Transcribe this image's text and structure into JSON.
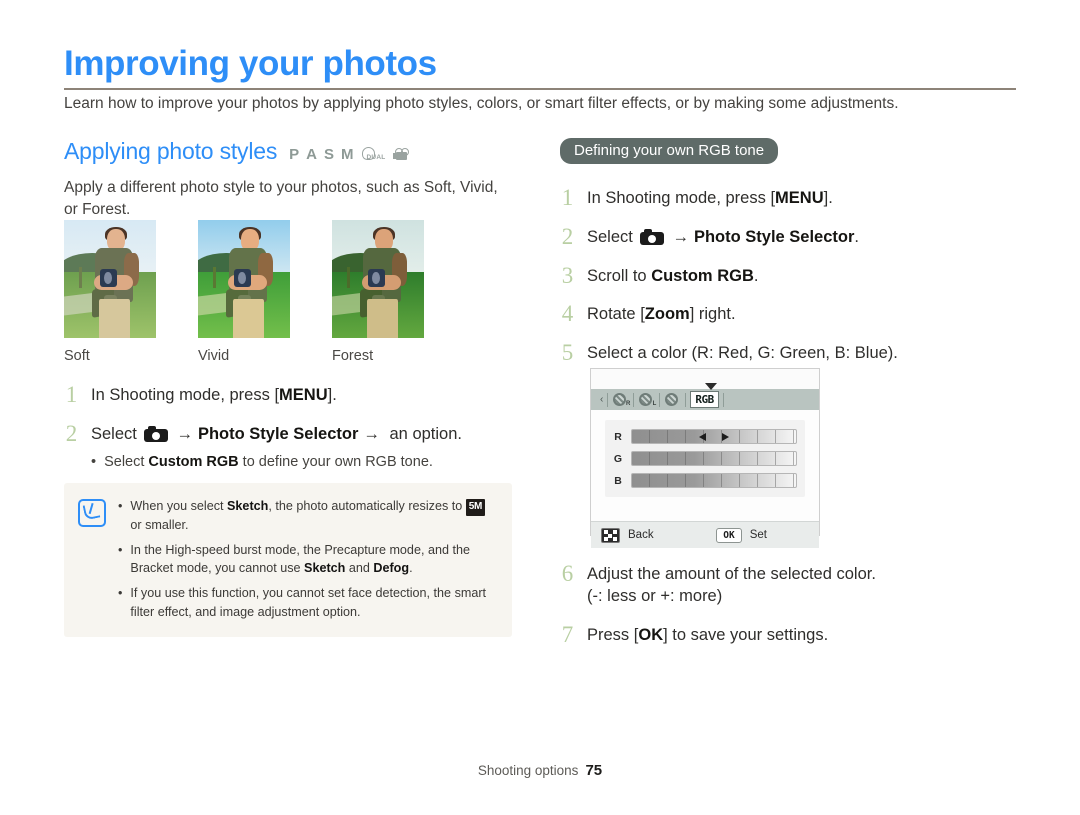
{
  "header": {
    "title": "Improving your photos",
    "intro": "Learn how to improve your photos by applying photo styles, colors, or smart filter effects, or by making some adjustments."
  },
  "left_column": {
    "section_title": "Applying photo styles",
    "modes": [
      "P",
      "A",
      "S",
      "M"
    ],
    "mode_icons": [
      "dual-is-icon",
      "movie-icon"
    ],
    "lead": "Apply a different photo style to your photos, such as Soft, Vivid, or Forest.",
    "samples": [
      {
        "label": "Soft"
      },
      {
        "label": "Vivid"
      },
      {
        "label": "Forest"
      }
    ],
    "steps": [
      {
        "num": "1",
        "pre": "In Shooting mode, press [",
        "key": "MENU",
        "post": "]."
      },
      {
        "num": "2",
        "pre": "Select ",
        "icon": "camera-icon",
        "arrow1": "→",
        "bold1": "Photo Style Selector",
        "arrow2": "→",
        "post": " an option.",
        "sub_bullet": {
          "pre": "Select ",
          "bold": "Custom RGB",
          "post": " to define your own RGB tone."
        }
      }
    ],
    "note": {
      "icon": "note-pen-icon",
      "items": [
        {
          "pre": "When you select ",
          "bold1": "Sketch",
          "mid": ", the photo automatically resizes to ",
          "badge": "5M",
          "post": " or smaller."
        },
        {
          "pre": "In the High-speed burst mode, the Precapture mode, and the Bracket mode, you cannot use ",
          "bold1": "Sketch",
          "mid": " and ",
          "bold2": "Defog",
          "post": "."
        },
        {
          "pre": "If you use this function, you cannot set face detection, the smart filter effect, and image adjustment option.",
          "bold1": "",
          "mid": "",
          "post": ""
        }
      ]
    }
  },
  "right_column": {
    "badge": "Defining your own RGB tone",
    "steps": [
      {
        "num": "1",
        "pre": "In Shooting mode, press [",
        "key": "MENU",
        "post": "]."
      },
      {
        "num": "2",
        "pre": "Select ",
        "icon": "camera-icon",
        "arrow1": "→",
        "bold1": "Photo Style Selector",
        "post": "."
      },
      {
        "num": "3",
        "pre": "Scroll to ",
        "bold1": "Custom RGB",
        "post": "."
      },
      {
        "num": "4",
        "pre": "Rotate [",
        "key": "Zoom",
        "post": "] right."
      },
      {
        "num": "5",
        "pre": "Select a color (R: Red, G: Green, B: Blue).",
        "post": ""
      },
      {
        "num": "6",
        "pre": "Adjust the amount of the selected color.",
        "line2": "(-: less or +: more)"
      },
      {
        "num": "7",
        "pre": "Press [",
        "key": "OK",
        "post": "] to save your settings."
      }
    ],
    "screen": {
      "back_arrow": "‹",
      "tabs": [
        "palette-icon-1",
        "palette-icon-2",
        "palette-icon-3"
      ],
      "active_tab": "RGB",
      "sliders": [
        {
          "label": "R",
          "value": 0,
          "has_adjust_arrows": true
        },
        {
          "label": "G",
          "value": 0,
          "has_adjust_arrows": false
        },
        {
          "label": "B",
          "value": 0,
          "has_adjust_arrows": false
        }
      ],
      "bottom_left_label": "Back",
      "bottom_left_icon": "fn-button-icon",
      "ok_button": "OK",
      "bottom_right_label": "Set"
    }
  },
  "footer": {
    "section": "Shooting options",
    "page": "75"
  },
  "colors": {
    "accent_blue": "#2e8ef7",
    "badge_gray": "#5f6b68",
    "number_green": "#b9cfa3",
    "rule_brown": "#8d8378",
    "note_bg": "#f7f5f0"
  }
}
